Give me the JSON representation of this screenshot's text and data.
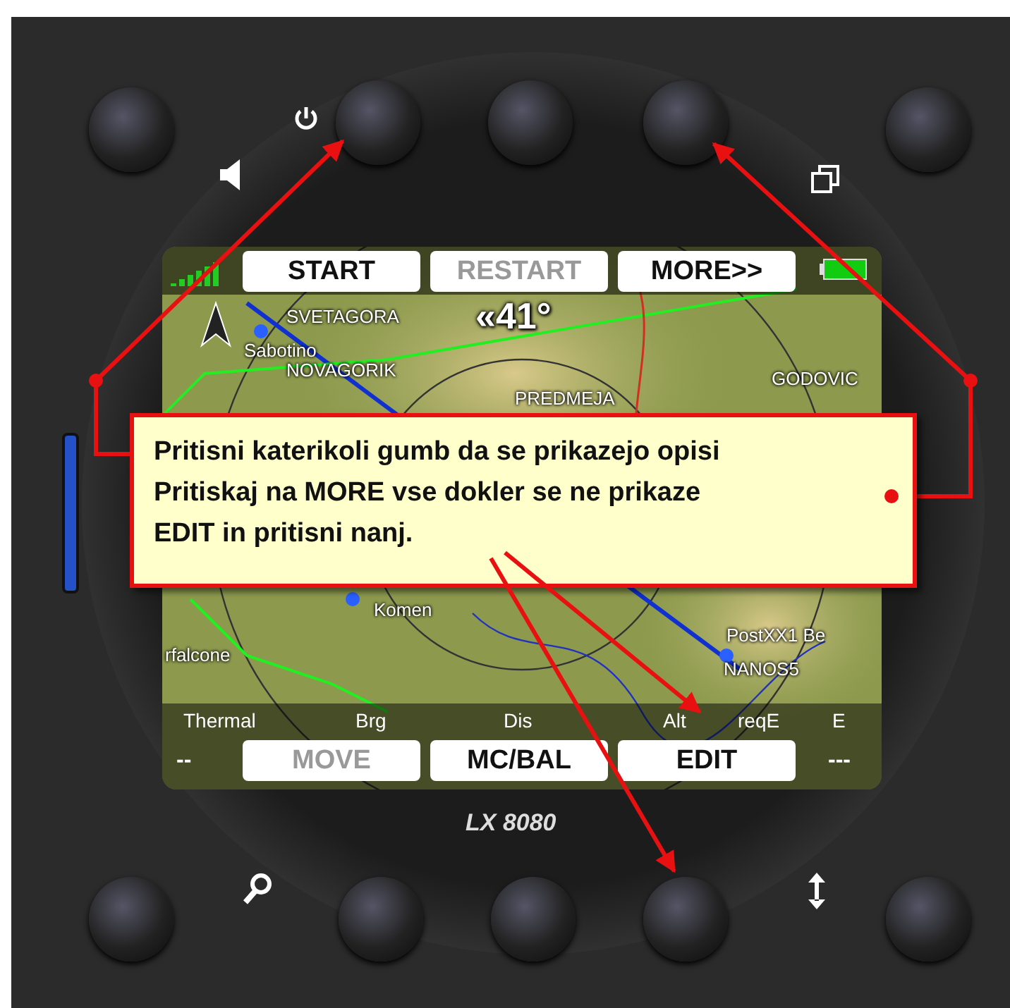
{
  "device": {
    "model": "LX 8080"
  },
  "screen": {
    "top_buttons": [
      {
        "label": "START",
        "disabled": false
      },
      {
        "label": "RESTART",
        "disabled": true
      },
      {
        "label": "MORE>>",
        "disabled": false
      }
    ],
    "heading": "«41°",
    "map_labels": [
      "SVETAGORA",
      "Sabotino",
      "NOVAGORIK",
      "PREDMEJA",
      "GODOVIC",
      "Komen",
      "rfalcone",
      "PostXX1 Be",
      "NANOS5"
    ],
    "data_labels": [
      "Thermal",
      "Brg",
      "Dis",
      "Alt",
      "reqE",
      "E"
    ],
    "data_values": [
      "--",
      "---"
    ],
    "bottom_buttons": [
      {
        "label": "MOVE",
        "disabled": true
      },
      {
        "label": "MC/BAL",
        "disabled": false
      },
      {
        "label": "EDIT",
        "disabled": false
      }
    ]
  },
  "callout": {
    "lines": [
      "Pritisni katerikoli gumb da se prikazejo opisi",
      "Pritiskaj na MORE vse dokler se ne prikaze",
      "EDIT in pritisni nanj."
    ]
  }
}
